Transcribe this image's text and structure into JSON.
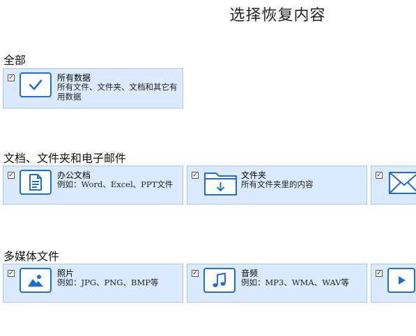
{
  "page_title": "选择恢复内容",
  "sections": {
    "all": {
      "label": "全部",
      "card": {
        "title": "所有数据",
        "desc": "所有文件、文件夹、文档和其它有用数据",
        "checked": true
      }
    },
    "docs": {
      "label": "文档、文件夹和电子邮件",
      "cards": [
        {
          "title": "办公文档",
          "desc": "例如：Word、Excel、PPT文件",
          "checked": true
        },
        {
          "title": "文件夹",
          "desc": "所有文件夹里的内容",
          "checked": true
        },
        {
          "title": "",
          "desc": "",
          "checked": true
        }
      ]
    },
    "media": {
      "label": "多媒体文件",
      "cards": [
        {
          "title": "照片",
          "desc": "例如：JPG、PNG、BMP等",
          "checked": true
        },
        {
          "title": "音频",
          "desc": "例如：MP3、WMA、WAV等",
          "checked": true
        },
        {
          "title": "",
          "desc": "",
          "checked": true
        }
      ]
    }
  },
  "checkbox_mark": "☑",
  "colors": {
    "card_bg": "#dbeafe",
    "card_border": "#a8c8ef",
    "icon_blue": "#1a6fd1"
  },
  "icons": [
    "check-icon",
    "document-icon",
    "folder-download-icon",
    "email-icon",
    "photo-icon",
    "music-note-icon",
    "video-play-icon"
  ]
}
